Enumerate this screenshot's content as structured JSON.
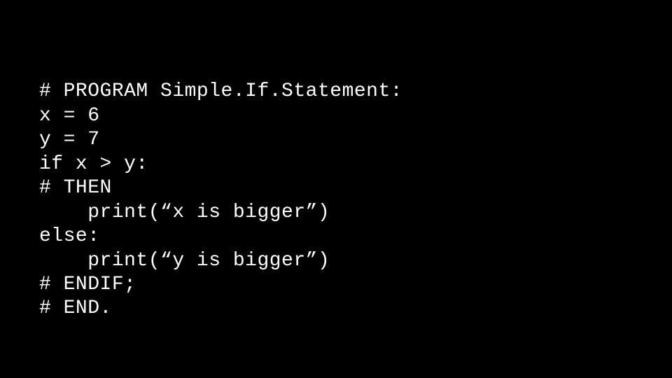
{
  "code": {
    "lines": [
      "# PROGRAM Simple.If.Statement:",
      "x = 6",
      "y = 7",
      "if x > y:",
      "# THEN",
      "    print(“x is bigger”)",
      "else:",
      "    print(“y is bigger”)",
      "# ENDIF;",
      "# END."
    ]
  }
}
